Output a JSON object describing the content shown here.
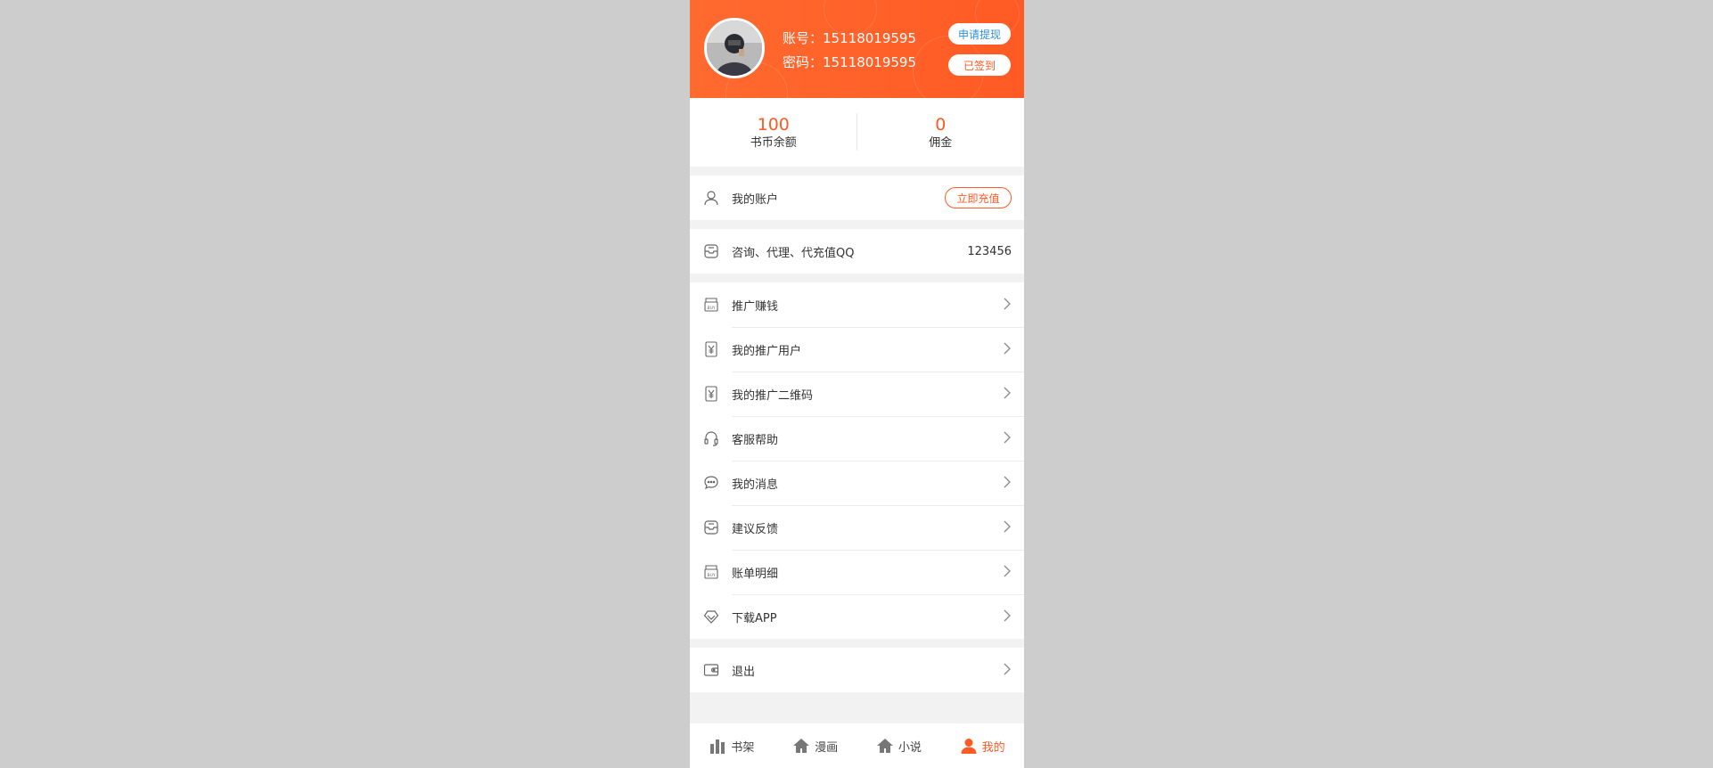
{
  "header": {
    "account_label": "账号：",
    "account_value": "15118019595",
    "password_label": "密码：",
    "password_value": "15118019595",
    "withdraw_button": "申请提现",
    "signin_button": "已签到"
  },
  "stats": [
    {
      "value": "100",
      "label": "书币余额"
    },
    {
      "value": "0",
      "label": "佣金"
    }
  ],
  "account_row": {
    "label": "我的账户",
    "button": "立即充值"
  },
  "contact_row": {
    "label": "咨询、代理、代充值QQ",
    "value": "123456"
  },
  "menu": [
    {
      "label": "推广赚钱",
      "icon": "buy-store-icon"
    },
    {
      "label": "我的推广用户",
      "icon": "yen-tag-icon"
    },
    {
      "label": "我的推广二维码",
      "icon": "yen-tag-icon"
    },
    {
      "label": "客服帮助",
      "icon": "headset-icon"
    },
    {
      "label": "我的消息",
      "icon": "chat-bubble-icon"
    },
    {
      "label": "建议反馈",
      "icon": "inbox-icon"
    },
    {
      "label": "账单明细",
      "icon": "buy-store-icon"
    },
    {
      "label": "下载APP",
      "icon": "diamond-icon"
    }
  ],
  "logout_row": {
    "label": "退出"
  },
  "tabbar": [
    {
      "label": "书架",
      "icon": "bar-chart-icon"
    },
    {
      "label": "漫画",
      "icon": "home-icon"
    },
    {
      "label": "小说",
      "icon": "home-icon"
    },
    {
      "label": "我的",
      "icon": "user-icon",
      "active": true
    }
  ],
  "colors": {
    "accent": "#ff5a24",
    "link": "#2f8fd8",
    "background": "#f2f2f2"
  }
}
